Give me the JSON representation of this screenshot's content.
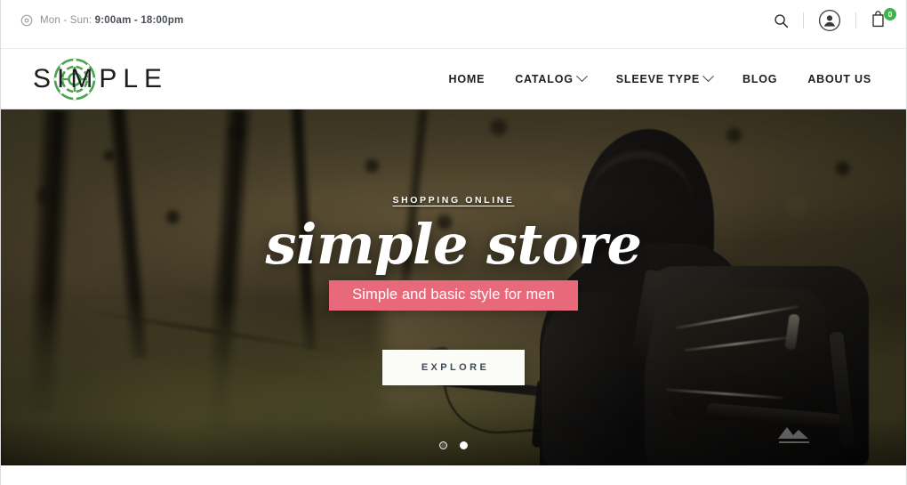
{
  "topbar": {
    "clock_icon": "clock-icon",
    "hours_prefix": "Mon - Sun:",
    "hours_value": "9:00am - 18:00pm",
    "search_icon": "search-icon",
    "account_icon": "user-account-icon",
    "cart_icon": "shopping-bag-icon",
    "cart_count": "0",
    "cart_badge_color": "#3db54a"
  },
  "header": {
    "logo_text": "SIMPLE",
    "logo_emblem_color": "#4aa34f",
    "nav": [
      {
        "label": "HOME",
        "has_dropdown": false
      },
      {
        "label": "CATALOG",
        "has_dropdown": true
      },
      {
        "label": "SLEEVE TYPE",
        "has_dropdown": true
      },
      {
        "label": "BLOG",
        "has_dropdown": false
      },
      {
        "label": "ABOUT US",
        "has_dropdown": false
      }
    ]
  },
  "hero": {
    "eyebrow": "SHOPPING ONLINE",
    "title": "simple store",
    "subtitle": "Simple and basic style for men",
    "subtitle_color": "#e8697a",
    "cta_label": "EXPLORE",
    "slides": [
      {
        "active": false
      },
      {
        "active": true
      }
    ]
  }
}
